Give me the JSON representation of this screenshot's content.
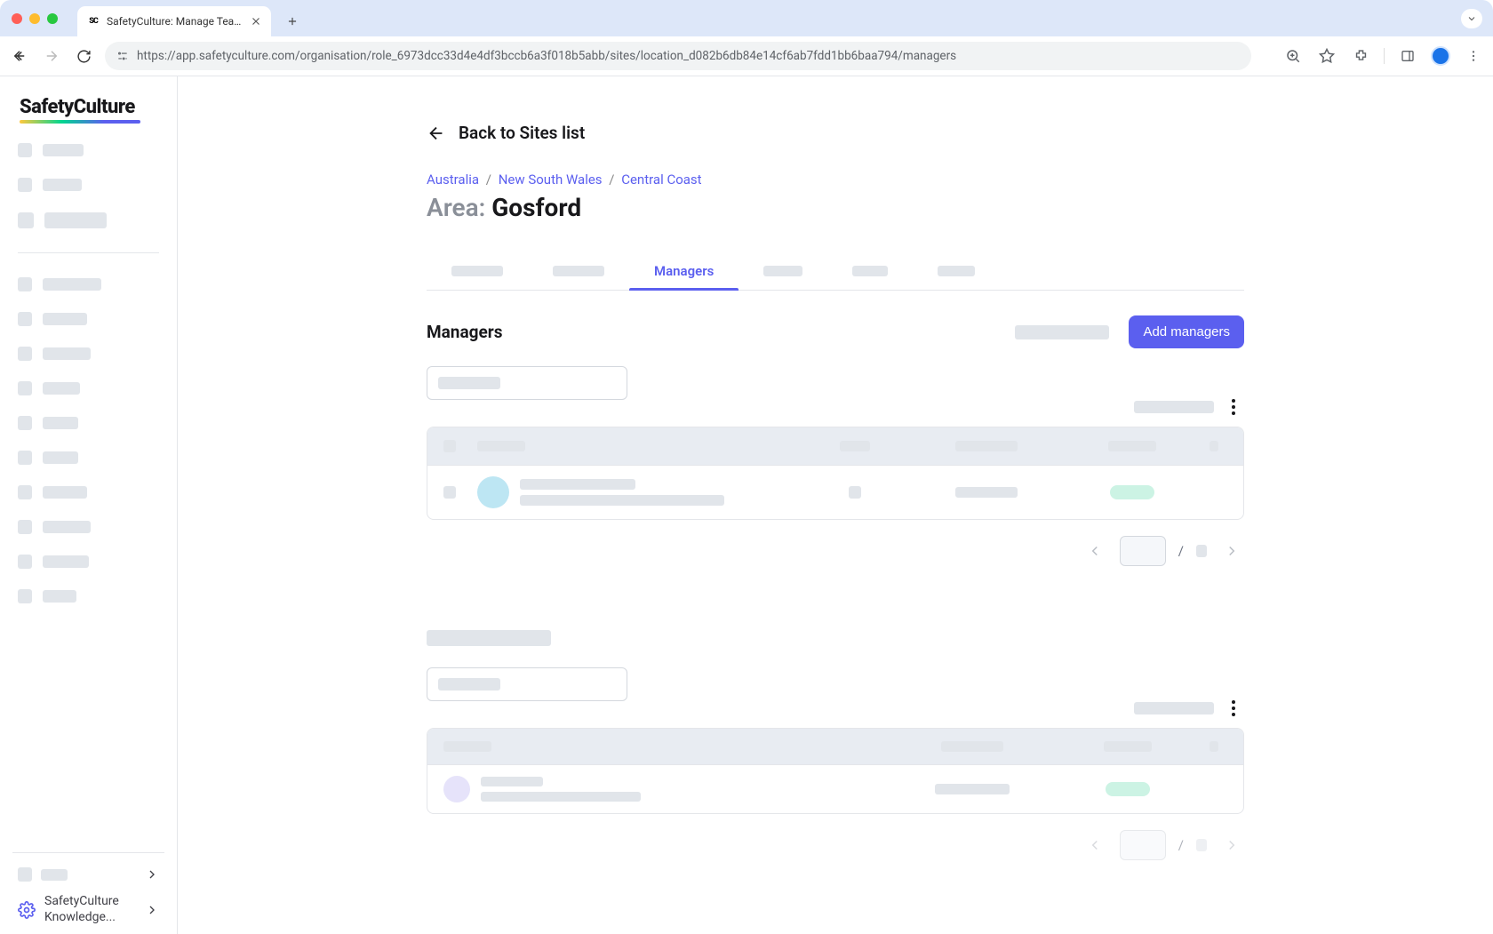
{
  "browser": {
    "tab_title": "SafetyCulture: Manage Teams and...",
    "url": "https://app.safetyculture.com/organisation/role_6973dcc33d4e4df3bccb6a3f018b5abb/sites/location_d082b6db84e14cf6ab7fdd1bb6baa794/managers"
  },
  "sidebar": {
    "logo": "SafetyCulture",
    "knowledge_label": "SafetyCulture Knowledge..."
  },
  "main": {
    "back_label": "Back to Sites list",
    "breadcrumbs": {
      "items": [
        "Australia",
        "New South Wales",
        "Central Coast"
      ]
    },
    "title_prefix": "Area:",
    "title_value": "Gosford",
    "tabs": {
      "active_label": "Managers"
    },
    "section1": {
      "title": "Managers",
      "add_button": "Add managers"
    },
    "pager": {
      "separator": "/"
    }
  }
}
